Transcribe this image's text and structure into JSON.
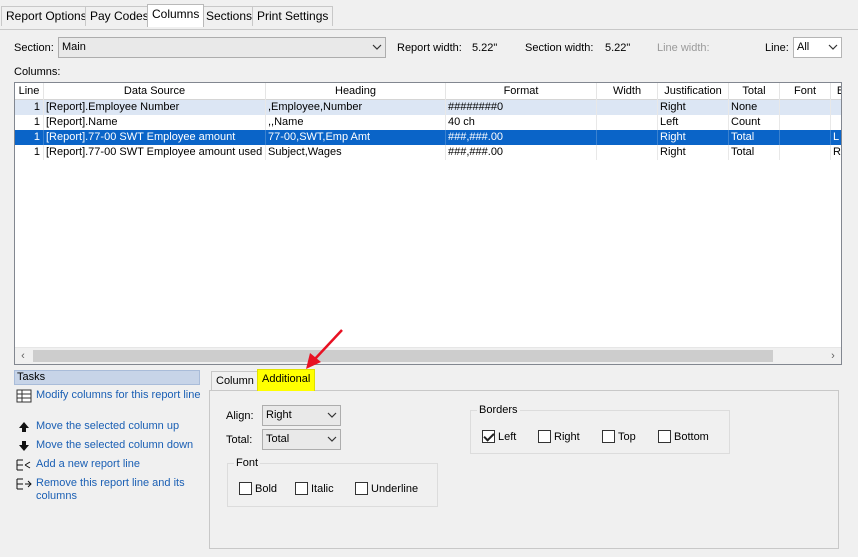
{
  "top_tabs": [
    "Report Options",
    "Pay Codes",
    "Columns",
    "Sections",
    "Print Settings"
  ],
  "active_top_tab": "Columns",
  "section_label": "Section:",
  "section_value": "Main",
  "report_width_label": "Report width:",
  "report_width_value": "5.22\"",
  "section_width_label": "Section width:",
  "section_width_value": "5.22\"",
  "line_width_label": "Line width:",
  "line_label": "Line:",
  "line_value": "All",
  "columns_label": "Columns:",
  "grid": {
    "headers": [
      "Line",
      "Data Source",
      "Heading",
      "Format",
      "Width",
      "Justification",
      "Total",
      "Font",
      "B"
    ],
    "rows": [
      [
        "1",
        "[Report].Employee Number",
        ",Employee,Number",
        "########0",
        "",
        "Right",
        "None",
        "",
        ""
      ],
      [
        "1",
        "[Report].Name",
        ",,Name",
        "40 ch",
        "",
        "Left",
        "Count",
        "",
        ""
      ],
      [
        "1",
        "[Report].77-00 SWT Employee amount",
        "77-00,SWT,Emp Amt",
        "###,###.00",
        "",
        "Right",
        "Total",
        "",
        "L"
      ],
      [
        "1",
        "[Report].77-00 SWT Employee amount used",
        "Subject,Wages",
        "###,###.00",
        "",
        "Right",
        "Total",
        "",
        "R"
      ]
    ],
    "selected_row": 2
  },
  "tasks": {
    "title": "Tasks",
    "items": [
      {
        "label": "Modify columns for this report line",
        "icon": "grid-edit-icon"
      },
      {
        "label": "Move the selected column up",
        "icon": "arrow-up-icon"
      },
      {
        "label": "Move the selected column down",
        "icon": "arrow-down-icon"
      },
      {
        "label": "Add a new report line",
        "icon": "add-line-icon"
      },
      {
        "label": "Remove this report line and its columns",
        "icon": "remove-line-icon"
      }
    ]
  },
  "sub_tabs": [
    "Column",
    "Additional"
  ],
  "active_sub_tab": "Additional",
  "additional": {
    "align_label": "Align:",
    "align_value": "Right",
    "total_label": "Total:",
    "total_value": "Total",
    "font_group": "Font",
    "font_options": [
      {
        "label": "Bold",
        "checked": false
      },
      {
        "label": "Italic",
        "checked": false
      },
      {
        "label": "Underline",
        "checked": false
      }
    ],
    "borders_group": "Borders",
    "border_options": [
      {
        "label": "Left",
        "checked": true
      },
      {
        "label": "Right",
        "checked": false
      },
      {
        "label": "Top",
        "checked": false
      },
      {
        "label": "Bottom",
        "checked": false
      }
    ]
  },
  "colors": {
    "selection": "#0a64c8",
    "highlight_tab": "#ffff00",
    "link": "#1a5fb4",
    "annotation_arrow": "#e81123"
  }
}
